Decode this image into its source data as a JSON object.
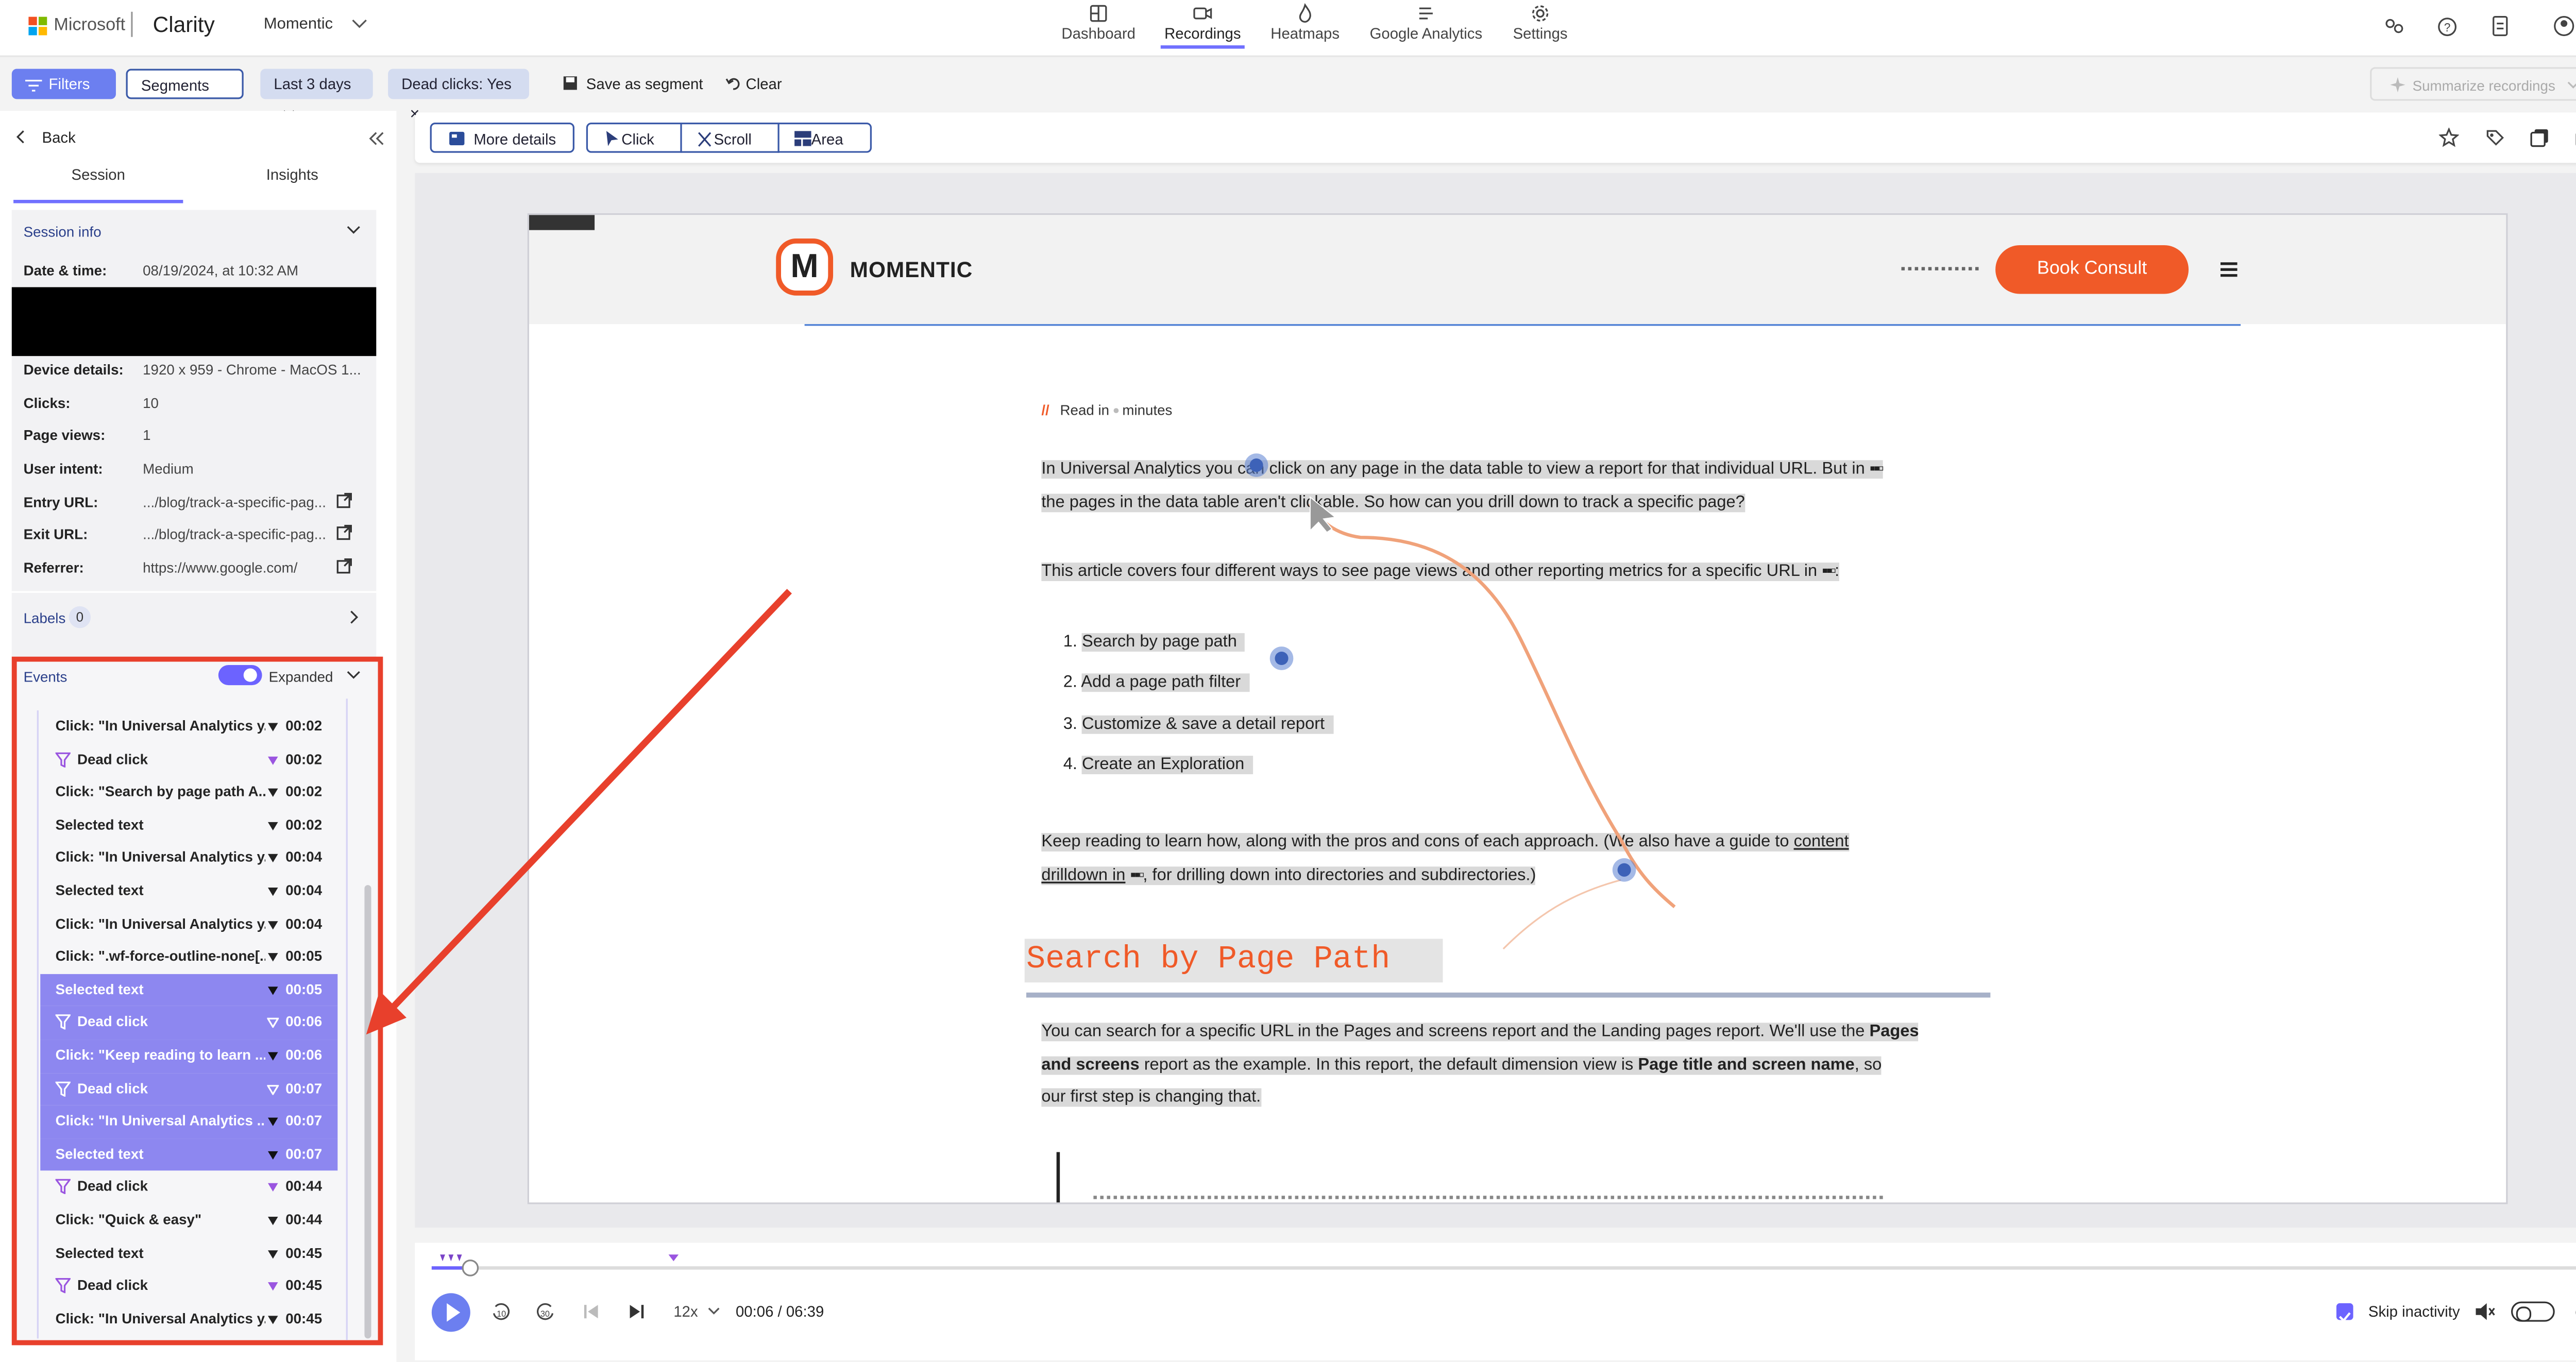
{
  "header": {
    "brand": "Microsoft",
    "product": "Clarity",
    "project": "Momentic",
    "nav": [
      {
        "label": "Dashboard",
        "icon": "dashboard-icon"
      },
      {
        "label": "Recordings",
        "icon": "camera-icon"
      },
      {
        "label": "Heatmaps",
        "icon": "flame-icon"
      },
      {
        "label": "Google Analytics",
        "icon": "analytics-icon"
      },
      {
        "label": "Settings",
        "icon": "gear-icon"
      }
    ],
    "active_tab": "Recordings"
  },
  "filterbar": {
    "filters": "Filters",
    "segments": "Segments",
    "date": "Last 3 days",
    "chip": "Dead clicks: Yes",
    "save": "Save as segment",
    "clear": "Clear",
    "summarize": "Summarize recordings"
  },
  "sidebar": {
    "back": "Back",
    "tabs": [
      "Session",
      "Insights"
    ],
    "session_info": "Session info",
    "fields": [
      {
        "k": "Date & time:",
        "v": "08/19/2024, at 10:32 AM"
      },
      {
        "k": "Device details:",
        "v": "1920 x 959 - Chrome - MacOS 1..."
      },
      {
        "k": "Clicks:",
        "v": "10"
      },
      {
        "k": "Page views:",
        "v": "1"
      },
      {
        "k": "User intent:",
        "v": "Medium"
      },
      {
        "k": "Entry URL:",
        "v": ".../blog/track-a-specific-pag..."
      },
      {
        "k": "Exit URL:",
        "v": ".../blog/track-a-specific-pag..."
      },
      {
        "k": "Referrer:",
        "v": "https://www.google.com/"
      }
    ],
    "labels": "Labels",
    "labels_count": "0",
    "events_title": "Events",
    "expanded": "Expanded",
    "events": [
      {
        "label": "Click: \"In Universal Analytics y...",
        "time": "00:02",
        "dead": false,
        "sel": false
      },
      {
        "label": "Dead click",
        "time": "00:02",
        "dead": true,
        "sel": false
      },
      {
        "label": "Click: \"Search by page path A...",
        "time": "00:02",
        "dead": false,
        "sel": false
      },
      {
        "label": "Selected text",
        "time": "00:02",
        "dead": false,
        "sel": false
      },
      {
        "label": "Click: \"In Universal Analytics y...",
        "time": "00:04",
        "dead": false,
        "sel": false
      },
      {
        "label": "Selected text",
        "time": "00:04",
        "dead": false,
        "sel": false
      },
      {
        "label": "Click: \"In Universal Analytics y...",
        "time": "00:04",
        "dead": false,
        "sel": false
      },
      {
        "label": "Click: \".wf-force-outline-none[...",
        "time": "00:05",
        "dead": false,
        "sel": false
      },
      {
        "label": "Selected text",
        "time": "00:05",
        "dead": false,
        "sel": true
      },
      {
        "label": "Dead click",
        "time": "00:06",
        "dead": true,
        "sel": true
      },
      {
        "label": "Click: \"Keep reading to learn ...",
        "time": "00:06",
        "dead": false,
        "sel": true
      },
      {
        "label": "Dead click",
        "time": "00:07",
        "dead": true,
        "sel": true
      },
      {
        "label": "Click: \"In Universal Analytics ...",
        "time": "00:07",
        "dead": false,
        "sel": true
      },
      {
        "label": "Selected text",
        "time": "00:07",
        "dead": false,
        "sel": true
      },
      {
        "label": "Dead click",
        "time": "00:44",
        "dead": true,
        "sel": false
      },
      {
        "label": "Click: \"Quick & easy\"",
        "time": "00:44",
        "dead": false,
        "sel": false
      },
      {
        "label": "Selected text",
        "time": "00:45",
        "dead": false,
        "sel": false
      },
      {
        "label": "Dead click",
        "time": "00:45",
        "dead": true,
        "sel": false
      },
      {
        "label": "Click: \"In Universal Analytics y...",
        "time": "00:45",
        "dead": false,
        "sel": false
      }
    ]
  },
  "toolbar": {
    "more_details": "More details",
    "click": "Click",
    "scroll": "Scroll",
    "area": "Area"
  },
  "site": {
    "logo_letter": "M",
    "logo_text": "MOMENTIC",
    "cta": "Book Consult",
    "read_prefix": "//",
    "read_text": "Read in",
    "read_suffix": "minutes",
    "para1a": "In Universal Analytics you can click on any page in the data table to view a report for that individual URL. But in",
    "para1b": "the pages in the data table aren't clickable. So how can you drill down to track a specific page?",
    "para2": "This article covers four different ways to see page views and other reporting metrics for a specific URL in",
    "list": [
      "Search by page path",
      "Add a page path filter",
      "Customize & save a detail report",
      "Create an Exploration"
    ],
    "para3a": "Keep reading to learn how, along with the pros and cons of each approach. (We also have a guide to",
    "para3_link1": "content",
    "para3_link2": "drilldown in",
    "para3b": ", for drilling down into directories and subdirectories.)",
    "heading": "Search by Page Path",
    "para4a": "You can search for a specific URL in the Pages and screens report and the Landing pages report. We'll use the",
    "para4_b1": "Pages",
    "para4_b2": "and screens",
    "para4b": "report as the example. In this report, the default dimension view is",
    "para4_b3": "Page title and screen name",
    "para4c": ", so",
    "para4d": "our first step is changing that."
  },
  "player": {
    "time": "00:06 / 06:39",
    "speed": "12x",
    "skip": "Skip inactivity",
    "progress": 0.004
  },
  "colors": {
    "accent": "#6c63ff",
    "selected_row": "#8d87f0",
    "brand_orange": "#f05a28",
    "annotation_red": "#e8402c"
  }
}
